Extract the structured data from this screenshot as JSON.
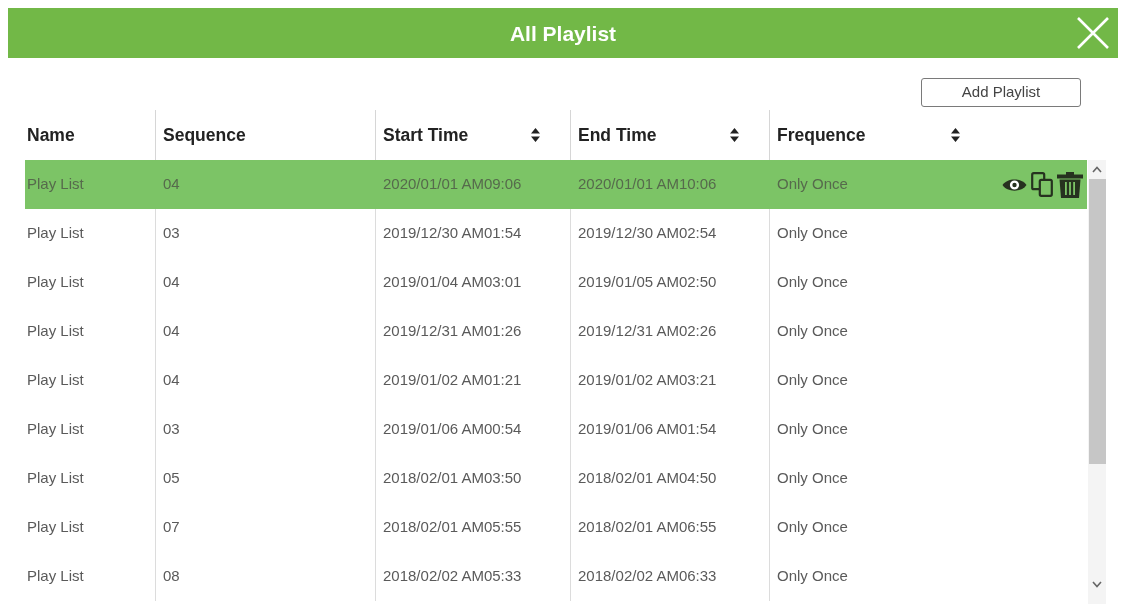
{
  "window": {
    "title": "All Playlist"
  },
  "toolbar": {
    "add_button": "Add Playlist"
  },
  "table": {
    "columns": [
      {
        "label": "Name",
        "sortable": false
      },
      {
        "label": "Sequence",
        "sortable": false
      },
      {
        "label": "Start Time",
        "sortable": true
      },
      {
        "label": "End Time",
        "sortable": true
      },
      {
        "label": "Frequence",
        "sortable": true
      }
    ],
    "rows": [
      {
        "selected": true,
        "cells": [
          "Play List",
          "04",
          "2020/01/01 AM09:06",
          "2020/01/01 AM10:06",
          "Only Once"
        ]
      },
      {
        "selected": false,
        "cells": [
          "Play List",
          "03",
          "2019/12/30 AM01:54",
          "2019/12/30 AM02:54",
          "Only Once"
        ]
      },
      {
        "selected": false,
        "cells": [
          "Play List",
          "04",
          "2019/01/04 AM03:01",
          "2019/01/05 AM02:50",
          "Only Once"
        ]
      },
      {
        "selected": false,
        "cells": [
          "Play List",
          "04",
          "2019/12/31 AM01:26",
          "2019/12/31 AM02:26",
          "Only Once"
        ]
      },
      {
        "selected": false,
        "cells": [
          "Play List",
          "04",
          "2019/01/02 AM01:21",
          "2019/01/02 AM03:21",
          "Only Once"
        ]
      },
      {
        "selected": false,
        "cells": [
          "Play List",
          "03",
          "2019/01/06 AM00:54",
          "2019/01/06 AM01:54",
          "Only Once"
        ]
      },
      {
        "selected": false,
        "cells": [
          "Play List",
          "05",
          "2018/02/01 AM03:50",
          "2018/02/01 AM04:50",
          "Only Once"
        ]
      },
      {
        "selected": false,
        "cells": [
          "Play List",
          "07",
          "2018/02/01 AM05:55",
          "2018/02/01 AM06:55",
          "Only Once"
        ]
      },
      {
        "selected": false,
        "cells": [
          "Play List",
          "08",
          "2018/02/02 AM05:33",
          "2018/02/02 AM06:33",
          "Only Once"
        ]
      }
    ]
  }
}
